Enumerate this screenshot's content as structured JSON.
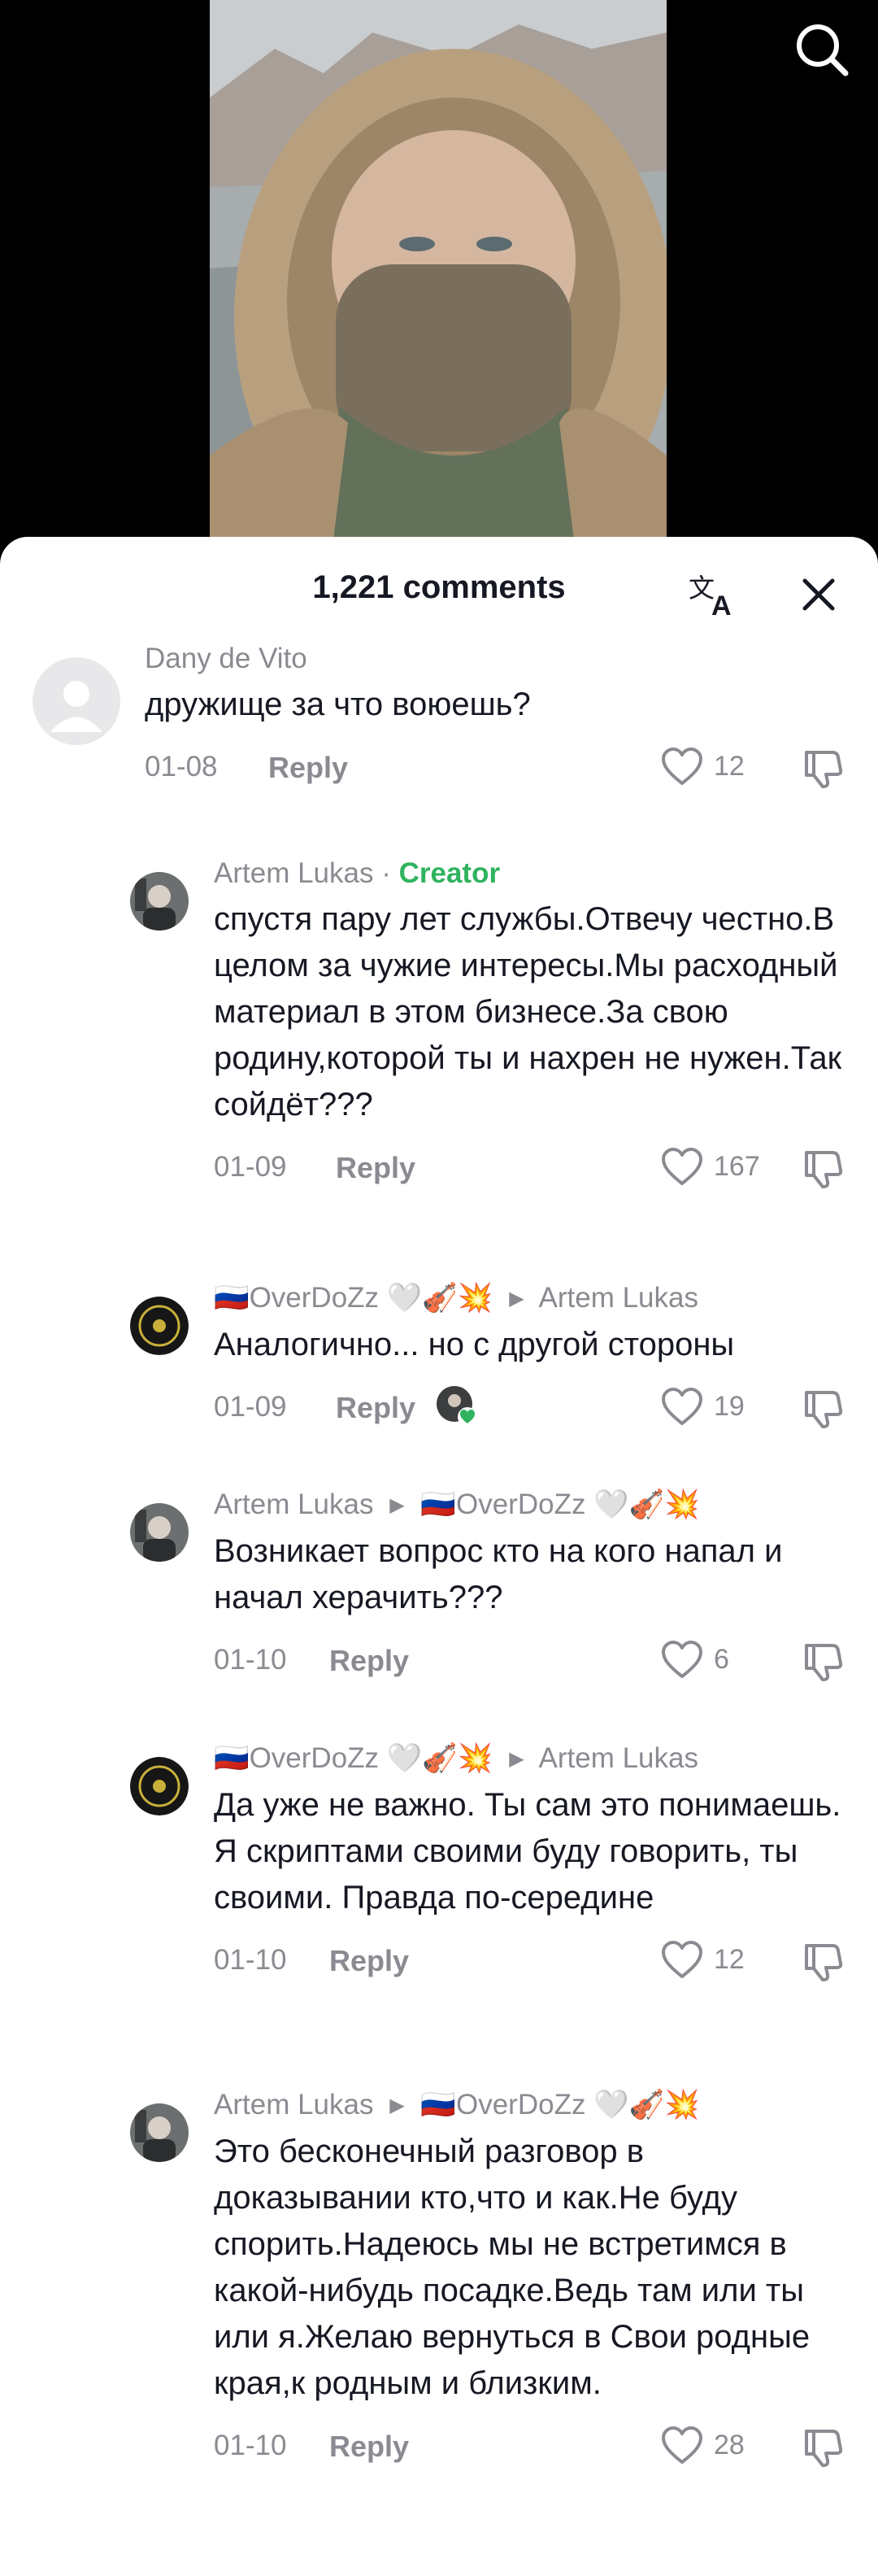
{
  "sheet": {
    "title": "1,221 comments"
  },
  "icons": {
    "search": "search-icon",
    "translate": "translate-icon",
    "close": "close-icon",
    "like": "heart-outline-icon",
    "dislike": "thumbs-down-icon"
  },
  "colors": {
    "creator_badge": "#2fb35e",
    "text_primary": "#161823",
    "text_secondary": "#8a8b91"
  },
  "comments": [
    {
      "author": "Dany de Vito",
      "text": "дружище за что воюешь?",
      "date": "01-08",
      "reply_label": "Reply",
      "likes": "12"
    },
    {
      "author": "Artem Lukas",
      "badge_separator": "·",
      "badge": "Creator",
      "text": "спустя пару лет службы.Отвечу честно.В целом за чужие интересы.Мы расходный материал в этом бизнесе.За свою родину,которой ты и нахрен не нужен.Так сойдёт???",
      "date": "01-09",
      "reply_label": "Reply",
      "likes": "167"
    },
    {
      "author": "🇷🇺OverDoZz 🤍🎻💥",
      "reply_to": "Artem Lukas",
      "text": "Аналогично... но с другой стороны",
      "date": "01-09",
      "reply_label": "Reply",
      "likes": "19"
    },
    {
      "author": "Artem Lukas",
      "reply_to": "🇷🇺OverDoZz 🤍🎻💥",
      "text": "Возникает вопрос кто на кого напал и начал херачить???",
      "date": "01-10",
      "reply_label": "Reply",
      "likes": "6"
    },
    {
      "author": "🇷🇺OverDoZz 🤍🎻💥",
      "reply_to": "Artem Lukas",
      "text": "Да уже не важно. Ты сам это понимаешь. Я скриптами своими буду говорить, ты своими. Правда по-середине",
      "date": "01-10",
      "reply_label": "Reply",
      "likes": "12"
    },
    {
      "author": "Artem Lukas",
      "reply_to": "🇷🇺OverDoZz 🤍🎻💥",
      "text": "Это бесконечный разговор в доказывании кто,что и как.Не буду спорить.Надеюсь мы не встретимся в какой-нибудь посадке.Ведь там или ты или я.Желаю вернуться в Свои родные края,к родным и близким.",
      "date": "01-10",
      "reply_label": "Reply",
      "likes": "28"
    }
  ]
}
